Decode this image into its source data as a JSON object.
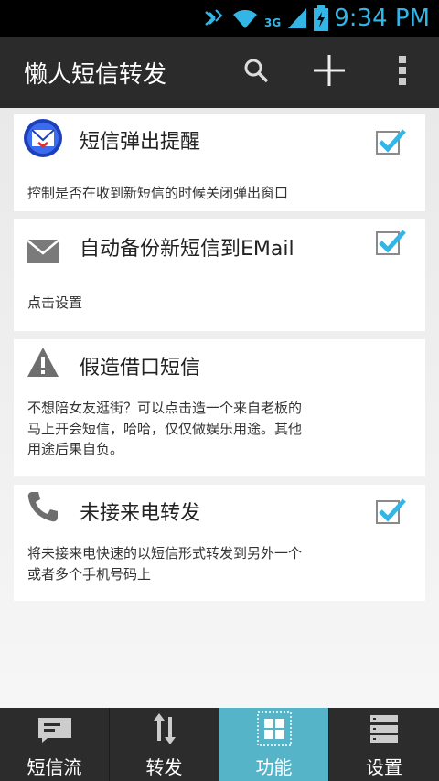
{
  "status_bar": {
    "time": "9:34 PM",
    "network_label": "3G",
    "icons": [
      "bluetooth-icon",
      "wifi-icon",
      "signal-icon",
      "battery-charging-icon"
    ]
  },
  "action_bar": {
    "title": "懒人短信转发",
    "icons": [
      "search-icon",
      "add-icon",
      "overflow-menu-icon"
    ]
  },
  "cards": [
    {
      "title": "短信弹出提醒",
      "description": "控制是否在收到新短信的时候关闭弹出窗口",
      "checked": true
    },
    {
      "title": "自动备份新短信到EMail",
      "description": "点击设置",
      "checked": true
    },
    {
      "title": "假造借口短信",
      "description_lines": [
        "不想陪女友逛街？可以点击造一个来自老板的",
        "马上开会短信，哈哈，仅仅做娱乐用途。其他",
        "用途后果自负。"
      ],
      "checked": false
    },
    {
      "title": "未接来电转发",
      "description_lines": [
        "将未接来电快速的以短信形式转发到另外一个",
        "或者多个手机号码上"
      ],
      "checked": true
    }
  ],
  "bottom_nav": {
    "items": [
      {
        "label": "短信流",
        "active": false
      },
      {
        "label": "转发",
        "active": false
      },
      {
        "label": "功能",
        "active": true
      },
      {
        "label": "设置",
        "active": false
      }
    ]
  },
  "colors": {
    "accent": "#33b5e5",
    "active_tab": "#56b4c9",
    "action_bar": "#2b2b2b"
  }
}
